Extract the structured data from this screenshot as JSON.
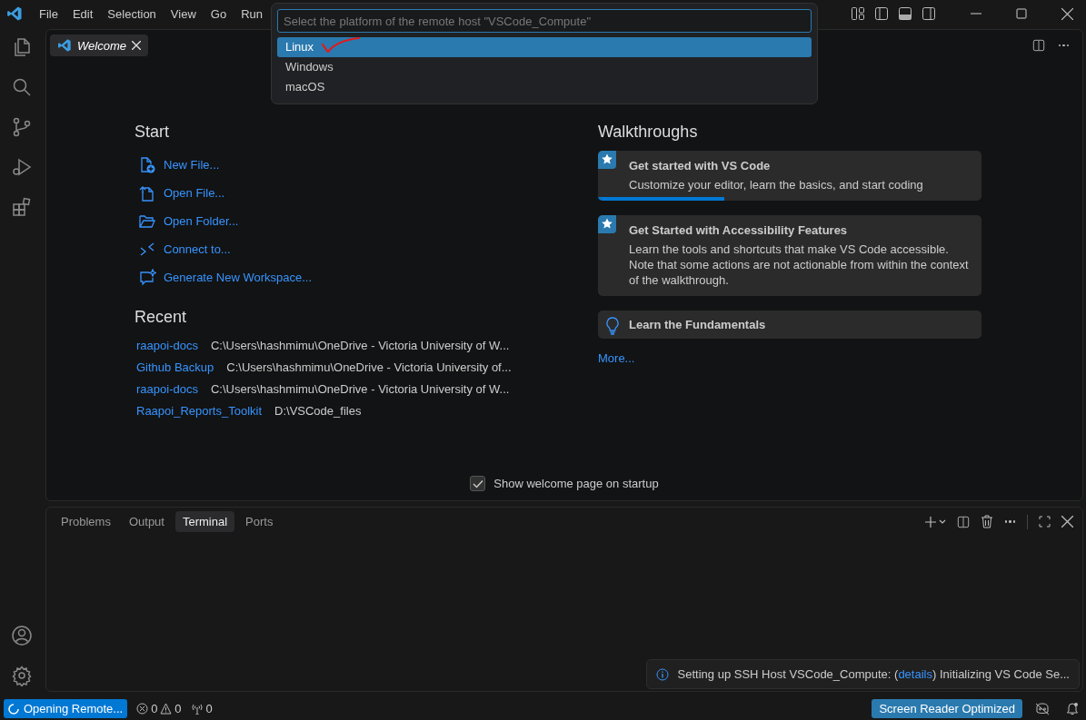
{
  "menu_bar": [
    "File",
    "Edit",
    "Selection",
    "View",
    "Go",
    "Run"
  ],
  "quick_pick": {
    "placeholder": "Select the platform of the remote host \"VSCode_Compute\"",
    "items": [
      {
        "label": "Linux",
        "selected": true
      },
      {
        "label": "Windows",
        "selected": false
      },
      {
        "label": "macOS",
        "selected": false
      }
    ]
  },
  "tabs": [
    {
      "label": "Welcome",
      "selected": true
    }
  ],
  "start": {
    "title": "Start",
    "items": [
      {
        "kind": "new-file",
        "label": "New File..."
      },
      {
        "kind": "open-file",
        "label": "Open File..."
      },
      {
        "kind": "open-folder",
        "label": "Open Folder..."
      },
      {
        "kind": "connect",
        "label": "Connect to..."
      },
      {
        "kind": "generate",
        "label": "Generate New Workspace..."
      }
    ]
  },
  "recent": {
    "title": "Recent",
    "items": [
      {
        "name": "raapoi-docs",
        "path": "C:\\Users\\hashmimu\\OneDrive - Victoria University of W..."
      },
      {
        "name": "Github Backup",
        "path": "C:\\Users\\hashmimu\\OneDrive - Victoria University of..."
      },
      {
        "name": "raapoi-docs",
        "path": "C:\\Users\\hashmimu\\OneDrive - Victoria University of W..."
      },
      {
        "name": "Raapoi_Reports_Toolkit",
        "path": "D:\\VSCode_files"
      }
    ]
  },
  "walkthroughs": {
    "title": "Walkthroughs",
    "items": [
      {
        "kind": "featured",
        "title": "Get started with VS Code",
        "description": "Customize your editor, learn the basics, and start coding",
        "level": 0.33
      },
      {
        "kind": "featured",
        "title": "Get Started with Accessibility Features",
        "description": "Learn the tools and shortcuts that make VS Code accessible. Note that some actions are not actionable from within the context of the walkthrough."
      },
      {
        "kind": "basic",
        "title": "Learn the Fundamentals"
      }
    ],
    "more": "More..."
  },
  "show_on_startup": {
    "label": "Show welcome page on startup",
    "checked": true
  },
  "panel": {
    "tabs": [
      {
        "label": "Problems",
        "selected": false
      },
      {
        "label": "Output",
        "selected": false
      },
      {
        "label": "Terminal",
        "selected": true
      },
      {
        "label": "Ports",
        "selected": false
      }
    ]
  },
  "notification": {
    "before": "Setting up SSH Host VSCode_Compute: (",
    "link": "details",
    "after": ") Initializing VS Code Se..."
  },
  "status_bar": {
    "remote": "Opening Remote...",
    "errors": "0",
    "warnings": "0",
    "ports": "0",
    "screen_reader": "Screen Reader Optimized"
  }
}
